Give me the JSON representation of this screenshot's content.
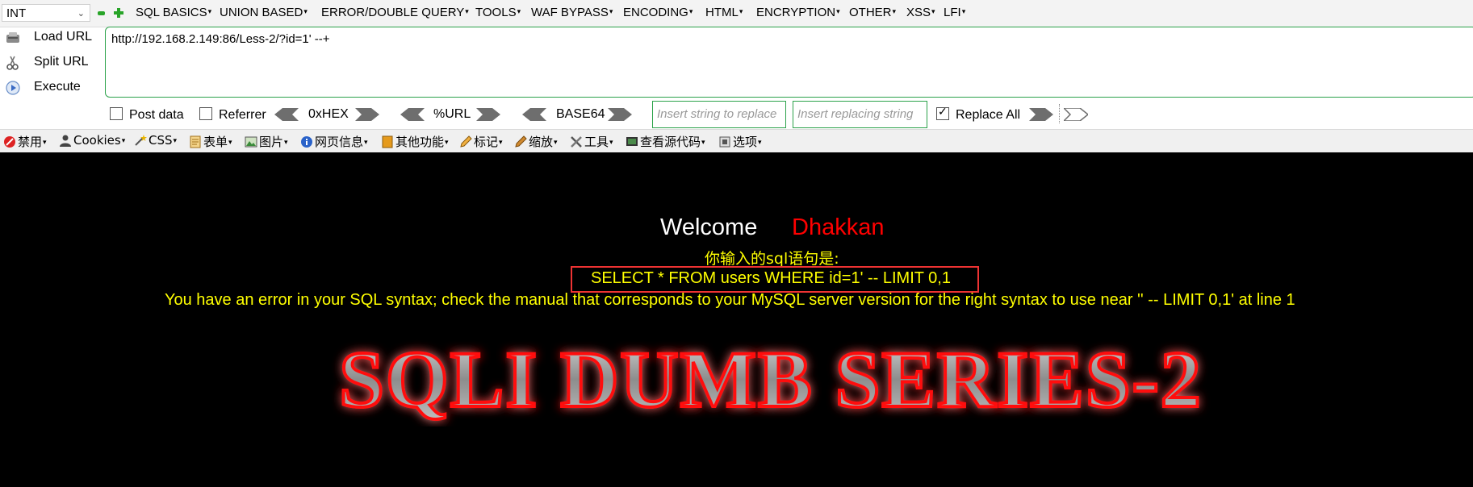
{
  "menubar": {
    "select_value": "INT",
    "items": [
      {
        "label": "SQL BASICS",
        "has_arrow": true
      },
      {
        "label": "UNION BASED",
        "has_arrow": true
      },
      {
        "label": "ERROR/DOUBLE QUERY",
        "has_arrow": true
      },
      {
        "label": "TOOLS",
        "has_arrow": true
      },
      {
        "label": "WAF BYPASS",
        "has_arrow": true
      },
      {
        "label": "ENCODING",
        "has_arrow": true
      },
      {
        "label": "HTML",
        "has_arrow": true
      },
      {
        "label": "ENCRYPTION",
        "has_arrow": true
      },
      {
        "label": "OTHER",
        "has_arrow": true
      },
      {
        "label": "XSS",
        "has_arrow": true
      },
      {
        "label": "LFI",
        "has_arrow": true
      }
    ]
  },
  "side": {
    "load_url": "Load URL",
    "split_url": "Split URL",
    "execute": "Execute"
  },
  "url": {
    "value": "http://192.168.2.149:86/Less-2/?id=1' --+"
  },
  "options": {
    "post_data": "Post data",
    "referrer": "Referrer",
    "hex": "0xHEX",
    "url_enc": "%URL",
    "base64": "BASE64",
    "insert_placeholder": "Insert string to replace",
    "replacing_placeholder": "Insert replacing string",
    "replace_all": "Replace All"
  },
  "toolbar2": [
    {
      "label": "禁用",
      "icon": "disable-icon"
    },
    {
      "label": "Cookies",
      "icon": "user-icon"
    },
    {
      "label": "CSS",
      "icon": "wand-icon"
    },
    {
      "label": "表单",
      "icon": "form-icon"
    },
    {
      "label": "图片",
      "icon": "image-icon"
    },
    {
      "label": "网页信息",
      "icon": "info-icon"
    },
    {
      "label": "其他功能",
      "icon": "book-icon"
    },
    {
      "label": "标记",
      "icon": "pencil-icon"
    },
    {
      "label": "缩放",
      "icon": "resize-icon"
    },
    {
      "label": "工具",
      "icon": "tools-icon"
    },
    {
      "label": "查看源代码",
      "icon": "source-icon"
    },
    {
      "label": "选项",
      "icon": "options-icon"
    }
  ],
  "content": {
    "welcome": "Welcome",
    "name": "Dhakkan",
    "sql_label": "你输入的sql语句是:",
    "query": "SELECT * FROM users WHERE id=1' -- LIMIT 0,1",
    "error": "You have an error in your SQL syntax; check the manual that corresponds to your MySQL server version for the right syntax to use near '' -- LIMIT 0,1' at line 1",
    "banner": "SQLI DUMB SERIES-2"
  }
}
